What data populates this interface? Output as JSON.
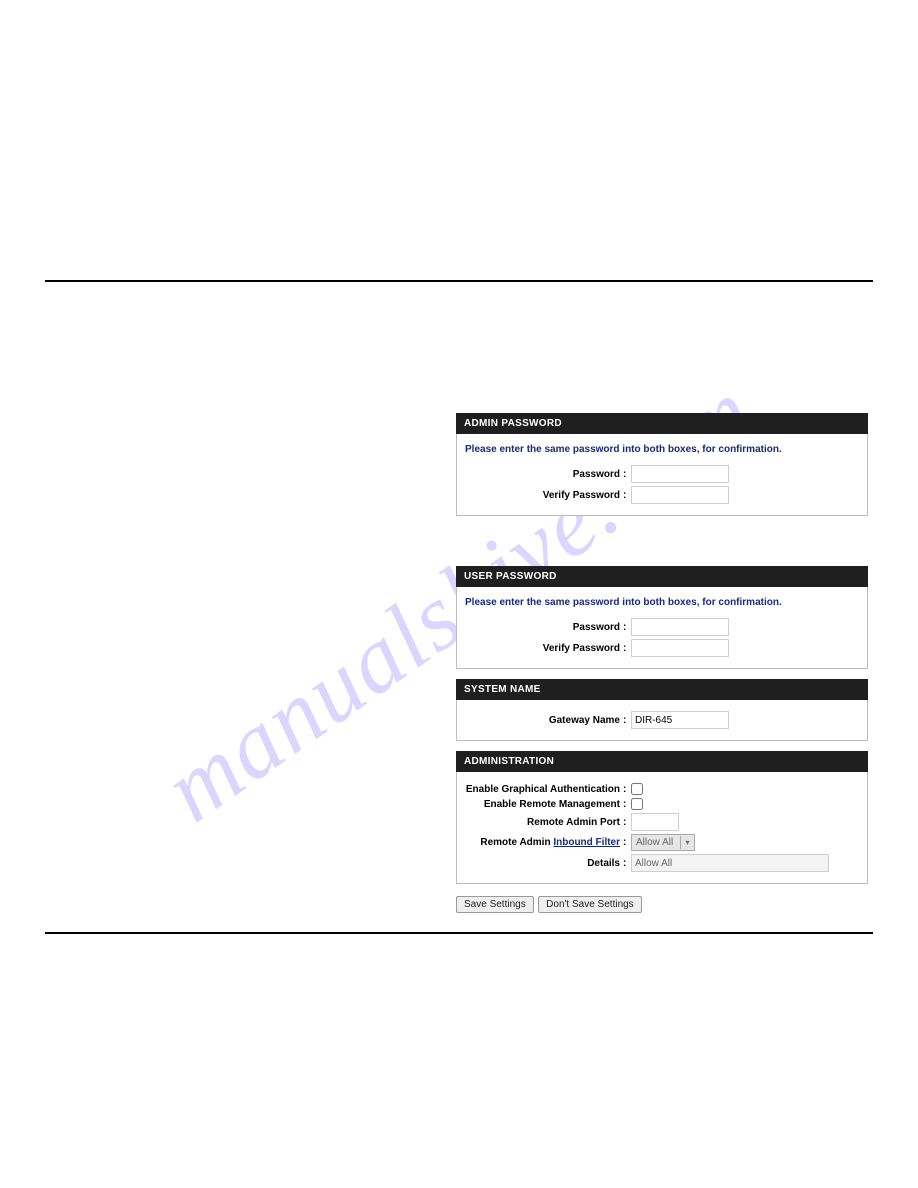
{
  "watermark": "manualshive.com",
  "sections": {
    "adminPassword": {
      "title": "ADMIN PASSWORD",
      "instruction": "Please enter the same password into both boxes, for confirmation.",
      "passwordLabel": "Password",
      "verifyLabel": "Verify Password"
    },
    "userPassword": {
      "title": "USER PASSWORD",
      "instruction": "Please enter the same password into both boxes, for confirmation.",
      "passwordLabel": "Password",
      "verifyLabel": "Verify Password"
    },
    "systemName": {
      "title": "SYSTEM NAME",
      "gatewayLabel": "Gateway Name",
      "gatewayValue": "DIR-645"
    },
    "administration": {
      "title": "ADMINISTRATION",
      "enableGraphicalLabel": "Enable Graphical Authentication",
      "enableRemoteLabel": "Enable Remote Management",
      "remotePortLabel": "Remote Admin Port",
      "remoteFilterPrefix": "Remote Admin ",
      "remoteFilterLink": "Inbound Filter",
      "remoteFilterValue": "Allow All",
      "detailsLabel": "Details",
      "detailsValue": "Allow All"
    }
  },
  "buttons": {
    "save": "Save Settings",
    "dontSave": "Don't Save Settings"
  }
}
